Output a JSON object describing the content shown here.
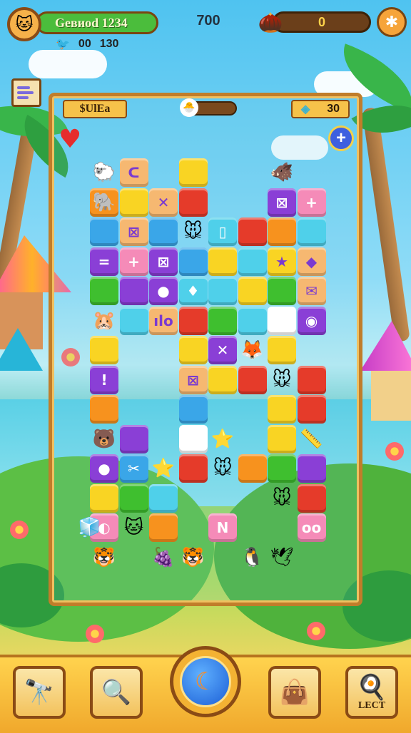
{
  "hud": {
    "player_name": "Gевиоd 1234",
    "score": "700",
    "coins": "0",
    "moves_label": "00",
    "moves_value": "130",
    "avatar_icon": "cat-face-icon",
    "settings_icon": "puzzle-gear-icon"
  },
  "board_header": {
    "label": "$UlEа",
    "gems": "30"
  },
  "colors": {
    "red": "#e53b2a",
    "orange": "#f7921e",
    "yellow": "#f9d423",
    "green": "#3fbf2f",
    "cyan": "#4fd0ea",
    "blue": "#3aa6e8",
    "purple": "#8a3fd6",
    "pink": "#f58bb8",
    "white": "#ffffff",
    "peach": "#f6b871"
  },
  "tiles": [
    {
      "c": "peach",
      "col": 1,
      "row": 0,
      "g": "ᑕ"
    },
    {
      "c": "yellow",
      "col": 3,
      "row": 0,
      "g": ""
    },
    {
      "c": "orange",
      "col": 0,
      "row": 1,
      "g": ""
    },
    {
      "c": "yellow",
      "col": 1,
      "row": 1,
      "g": ""
    },
    {
      "c": "peach",
      "col": 2,
      "row": 1,
      "g": "✕"
    },
    {
      "c": "red",
      "col": 3,
      "row": 1,
      "g": ""
    },
    {
      "c": "purple",
      "col": 6,
      "row": 1,
      "g": "⊠"
    },
    {
      "c": "pink",
      "col": 7,
      "row": 1,
      "g": "+"
    },
    {
      "c": "blue",
      "col": 0,
      "row": 2,
      "g": ""
    },
    {
      "c": "peach",
      "col": 1,
      "row": 2,
      "g": "⊠"
    },
    {
      "c": "blue",
      "col": 2,
      "row": 2,
      "g": ""
    },
    {
      "c": "cyan",
      "col": 4,
      "row": 2,
      "g": "▯"
    },
    {
      "c": "red",
      "col": 5,
      "row": 2,
      "g": ""
    },
    {
      "c": "orange",
      "col": 6,
      "row": 2,
      "g": ""
    },
    {
      "c": "cyan",
      "col": 7,
      "row": 2,
      "g": ""
    },
    {
      "c": "purple",
      "col": 0,
      "row": 3,
      "g": "="
    },
    {
      "c": "pink",
      "col": 1,
      "row": 3,
      "g": "+"
    },
    {
      "c": "purple",
      "col": 2,
      "row": 3,
      "g": "⊠"
    },
    {
      "c": "blue",
      "col": 3,
      "row": 3,
      "g": ""
    },
    {
      "c": "yellow",
      "col": 4,
      "row": 3,
      "g": ""
    },
    {
      "c": "cyan",
      "col": 5,
      "row": 3,
      "g": ""
    },
    {
      "c": "yellow",
      "col": 6,
      "row": 3,
      "g": "★"
    },
    {
      "c": "peach",
      "col": 7,
      "row": 3,
      "g": "◆"
    },
    {
      "c": "green",
      "col": 0,
      "row": 4,
      "g": ""
    },
    {
      "c": "purple",
      "col": 1,
      "row": 4,
      "g": ""
    },
    {
      "c": "purple",
      "col": 2,
      "row": 4,
      "g": "●"
    },
    {
      "c": "cyan",
      "col": 3,
      "row": 4,
      "g": "♦"
    },
    {
      "c": "cyan",
      "col": 4,
      "row": 4,
      "g": ""
    },
    {
      "c": "yellow",
      "col": 5,
      "row": 4,
      "g": ""
    },
    {
      "c": "green",
      "col": 6,
      "row": 4,
      "g": ""
    },
    {
      "c": "peach",
      "col": 7,
      "row": 4,
      "g": "✉"
    },
    {
      "c": "cyan",
      "col": 1,
      "row": 5,
      "g": ""
    },
    {
      "c": "peach",
      "col": 2,
      "row": 5,
      "g": "ılo"
    },
    {
      "c": "red",
      "col": 3,
      "row": 5,
      "g": ""
    },
    {
      "c": "green",
      "col": 4,
      "row": 5,
      "g": ""
    },
    {
      "c": "cyan",
      "col": 5,
      "row": 5,
      "g": ""
    },
    {
      "c": "white",
      "col": 6,
      "row": 5,
      "g": ""
    },
    {
      "c": "purple",
      "col": 7,
      "row": 5,
      "g": "◉"
    },
    {
      "c": "yellow",
      "col": 0,
      "row": 6,
      "g": ""
    },
    {
      "c": "yellow",
      "col": 3,
      "row": 6,
      "g": ""
    },
    {
      "c": "purple",
      "col": 4,
      "row": 6,
      "g": "✕"
    },
    {
      "c": "yellow",
      "col": 6,
      "row": 6,
      "g": ""
    },
    {
      "c": "purple",
      "col": 0,
      "row": 7,
      "g": "!"
    },
    {
      "c": "peach",
      "col": 3,
      "row": 7,
      "g": "⊠"
    },
    {
      "c": "yellow",
      "col": 4,
      "row": 7,
      "g": ""
    },
    {
      "c": "red",
      "col": 5,
      "row": 7,
      "g": ""
    },
    {
      "c": "red",
      "col": 7,
      "row": 7,
      "g": ""
    },
    {
      "c": "orange",
      "col": 0,
      "row": 8,
      "g": ""
    },
    {
      "c": "blue",
      "col": 3,
      "row": 8,
      "g": ""
    },
    {
      "c": "yellow",
      "col": 6,
      "row": 8,
      "g": ""
    },
    {
      "c": "red",
      "col": 7,
      "row": 8,
      "g": ""
    },
    {
      "c": "purple",
      "col": 1,
      "row": 9,
      "g": ""
    },
    {
      "c": "white",
      "col": 3,
      "row": 9,
      "g": ""
    },
    {
      "c": "yellow",
      "col": 6,
      "row": 9,
      "g": ""
    },
    {
      "c": "purple",
      "col": 0,
      "row": 10,
      "g": "●"
    },
    {
      "c": "blue",
      "col": 1,
      "row": 10,
      "g": "✂"
    },
    {
      "c": "red",
      "col": 3,
      "row": 10,
      "g": ""
    },
    {
      "c": "orange",
      "col": 5,
      "row": 10,
      "g": ""
    },
    {
      "c": "green",
      "col": 6,
      "row": 10,
      "g": ""
    },
    {
      "c": "purple",
      "col": 7,
      "row": 10,
      "g": ""
    },
    {
      "c": "yellow",
      "col": 0,
      "row": 11,
      "g": ""
    },
    {
      "c": "green",
      "col": 1,
      "row": 11,
      "g": ""
    },
    {
      "c": "cyan",
      "col": 2,
      "row": 11,
      "g": ""
    },
    {
      "c": "red",
      "col": 7,
      "row": 11,
      "g": ""
    },
    {
      "c": "pink",
      "col": 0,
      "row": 12,
      "g": "◐"
    },
    {
      "c": "orange",
      "col": 2,
      "row": 12,
      "g": ""
    },
    {
      "c": "pink",
      "col": 4,
      "row": 12,
      "g": "N"
    },
    {
      "c": "pink",
      "col": 7,
      "row": 12,
      "g": "oo"
    }
  ],
  "critters": [
    {
      "g": "🐑",
      "col": 0,
      "row": 0
    },
    {
      "g": "🐗",
      "col": 6,
      "row": 0
    },
    {
      "g": "🐘",
      "col": 0,
      "row": 1
    },
    {
      "g": "🐭",
      "col": 3,
      "row": 2
    },
    {
      "g": "🐹",
      "col": 0,
      "row": 5
    },
    {
      "g": "🦊",
      "col": 5,
      "row": 6
    },
    {
      "g": "🐭",
      "col": 6,
      "row": 7
    },
    {
      "g": "🐻",
      "col": 0,
      "row": 9
    },
    {
      "g": "⭐",
      "col": 4,
      "row": 9
    },
    {
      "g": "📏",
      "col": 7,
      "row": 9
    },
    {
      "g": "⭐",
      "col": 2,
      "row": 10
    },
    {
      "g": "🐭",
      "col": 4,
      "row": 10
    },
    {
      "g": "🐭",
      "col": 6,
      "row": 11
    },
    {
      "g": "🐱",
      "col": 1,
      "row": 12
    },
    {
      "g": "🐯",
      "col": 0,
      "row": 13
    },
    {
      "g": "🍇",
      "col": 2,
      "row": 13
    },
    {
      "g": "🐯",
      "col": 3,
      "row": 13
    },
    {
      "g": "🐧",
      "col": 5,
      "row": 13
    },
    {
      "g": "🕊",
      "col": 6,
      "row": 13
    },
    {
      "g": "🧊",
      "col": -0.5,
      "row": 12
    }
  ],
  "bottom_bar": {
    "btn1_icon": "telescope-icon",
    "btn2_icon": "magnifier-gear-icon",
    "center_icon": "moon-leaf-icon",
    "btn4_icon": "gift-bag-icon",
    "btn5_label": "LECT",
    "btn5_icon": "chef-hat-icon"
  }
}
